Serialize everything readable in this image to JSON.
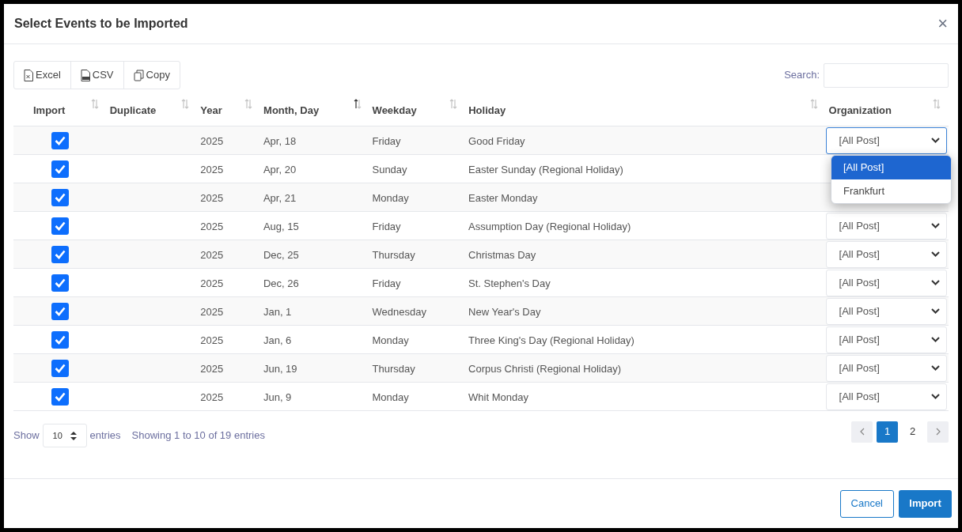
{
  "dialog": {
    "title": "Select Events to be Imported",
    "close": "×"
  },
  "export_buttons": [
    "Excel",
    "CSV",
    "Copy"
  ],
  "search": {
    "label": "Search:"
  },
  "table": {
    "columns": [
      {
        "label": "Import",
        "sorted": false
      },
      {
        "label": "Duplicate",
        "sorted": false
      },
      {
        "label": "Year",
        "sorted": false
      },
      {
        "label": "Month, Day",
        "sorted": true
      },
      {
        "label": "Weekday",
        "sorted": false
      },
      {
        "label": "Holiday",
        "sorted": false
      },
      {
        "label": "Organization",
        "sorted": false
      }
    ],
    "rows": [
      {
        "import": true,
        "year": "2025",
        "date": "Apr, 18",
        "weekday": "Friday",
        "holiday": "Good Friday",
        "organization": "[All Post]",
        "focused": true
      },
      {
        "import": true,
        "year": "2025",
        "date": "Apr, 20",
        "weekday": "Sunday",
        "holiday": "Easter Sunday (Regional Holiday)"
      },
      {
        "import": true,
        "year": "2025",
        "date": "Apr, 21",
        "weekday": "Monday",
        "holiday": "Easter Monday"
      },
      {
        "import": true,
        "year": "2025",
        "date": "Aug, 15",
        "weekday": "Friday",
        "holiday": "Assumption Day (Regional Holiday)",
        "organization": "[All Post]",
        "focused": false
      },
      {
        "import": true,
        "year": "2025",
        "date": "Dec, 25",
        "weekday": "Thursday",
        "holiday": "Christmas Day",
        "organization": "[All Post]",
        "focused": false
      },
      {
        "import": true,
        "year": "2025",
        "date": "Dec, 26",
        "weekday": "Friday",
        "holiday": "St. Stephen's Day",
        "organization": "[All Post]",
        "focused": false
      },
      {
        "import": true,
        "year": "2025",
        "date": "Jan, 1",
        "weekday": "Wednesday",
        "holiday": "New Year's Day",
        "organization": "[All Post]",
        "focused": false
      },
      {
        "import": true,
        "year": "2025",
        "date": "Jan, 6",
        "weekday": "Monday",
        "holiday": "Three King's Day (Regional Holiday)",
        "organization": "[All Post]",
        "focused": false
      },
      {
        "import": true,
        "year": "2025",
        "date": "Jun, 19",
        "weekday": "Thursday",
        "holiday": "Corpus Christi (Regional Holiday)",
        "organization": "[All Post]",
        "focused": false
      },
      {
        "import": true,
        "year": "2025",
        "date": "Jun, 9",
        "weekday": "Monday",
        "holiday": "Whit Monday",
        "organization": "[All Post]",
        "focused": false
      }
    ]
  },
  "dropdown": {
    "options": [
      {
        "label": "[All Post]",
        "selected": true
      },
      {
        "label": "Frankfurt",
        "selected": false
      }
    ]
  },
  "length": {
    "prefix": "Show",
    "value": "10",
    "suffix": "entries"
  },
  "info": "Showing 1 to 10 of 19 entries",
  "pagination": {
    "pages": [
      {
        "label": "1",
        "selected": true
      },
      {
        "label": "2",
        "selected": false
      }
    ]
  },
  "footer_buttons": [
    {
      "label": "Cancel",
      "kind": "secondary"
    },
    {
      "label": "Import",
      "kind": "primary"
    }
  ]
}
